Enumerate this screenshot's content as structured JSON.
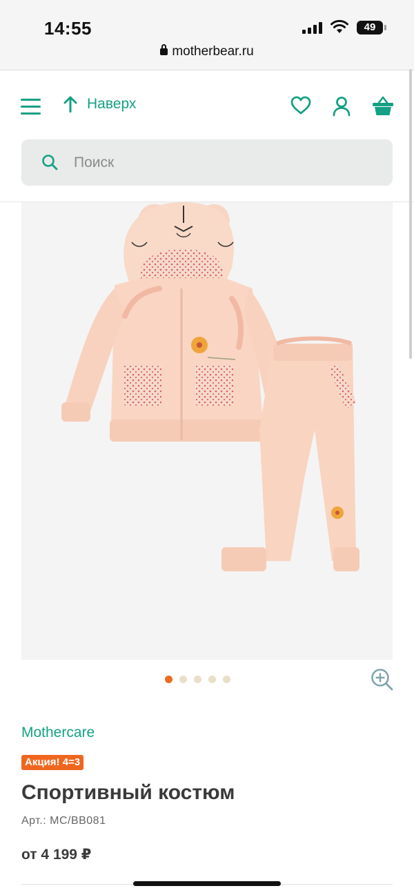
{
  "status_bar": {
    "time": "14:55",
    "battery": "49",
    "url": "motherbear.ru"
  },
  "header": {
    "menu_icon": "hamburger-menu-icon",
    "up_label": "Наверх",
    "up_icon": "arrow-up-icon",
    "actions": [
      "heart-icon",
      "user-icon",
      "basket-icon"
    ],
    "accent_color": "#14a085"
  },
  "search": {
    "placeholder": "Поиск"
  },
  "gallery": {
    "slide_count": 5,
    "active_slide": 1,
    "zoom_icon": "zoom-in-icon"
  },
  "product": {
    "brand": "Mothercare",
    "promo": "Акция! 4=3",
    "title": "Спортивный костюм",
    "sku": "Арт.: MC/BB081",
    "price": "от 4 199 ₽",
    "promo_color": "#f0661e"
  }
}
